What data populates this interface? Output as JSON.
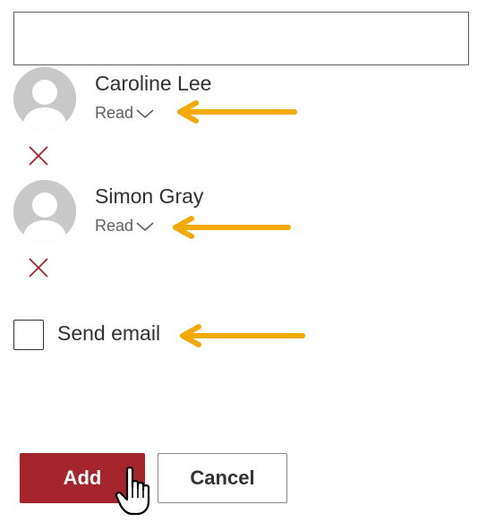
{
  "picker": {
    "value": ""
  },
  "people": [
    {
      "name": "Caroline Lee",
      "permission": "Read"
    },
    {
      "name": "Simon Gray",
      "permission": "Read"
    }
  ],
  "send_email": {
    "label": "Send email",
    "checked": false
  },
  "actions": {
    "add_label": "Add",
    "cancel_label": "Cancel"
  },
  "colors": {
    "accent": "#a4262c",
    "annotation_arrow": "#f2a900",
    "remove_icon": "#a4262c",
    "avatar_bg": "#c8c8c8"
  },
  "icons": {
    "remove": "close-icon",
    "permission_dropdown": "chevron-down-icon",
    "annotation": "arrow-left-icon",
    "pointer": "hand-pointer-icon"
  }
}
